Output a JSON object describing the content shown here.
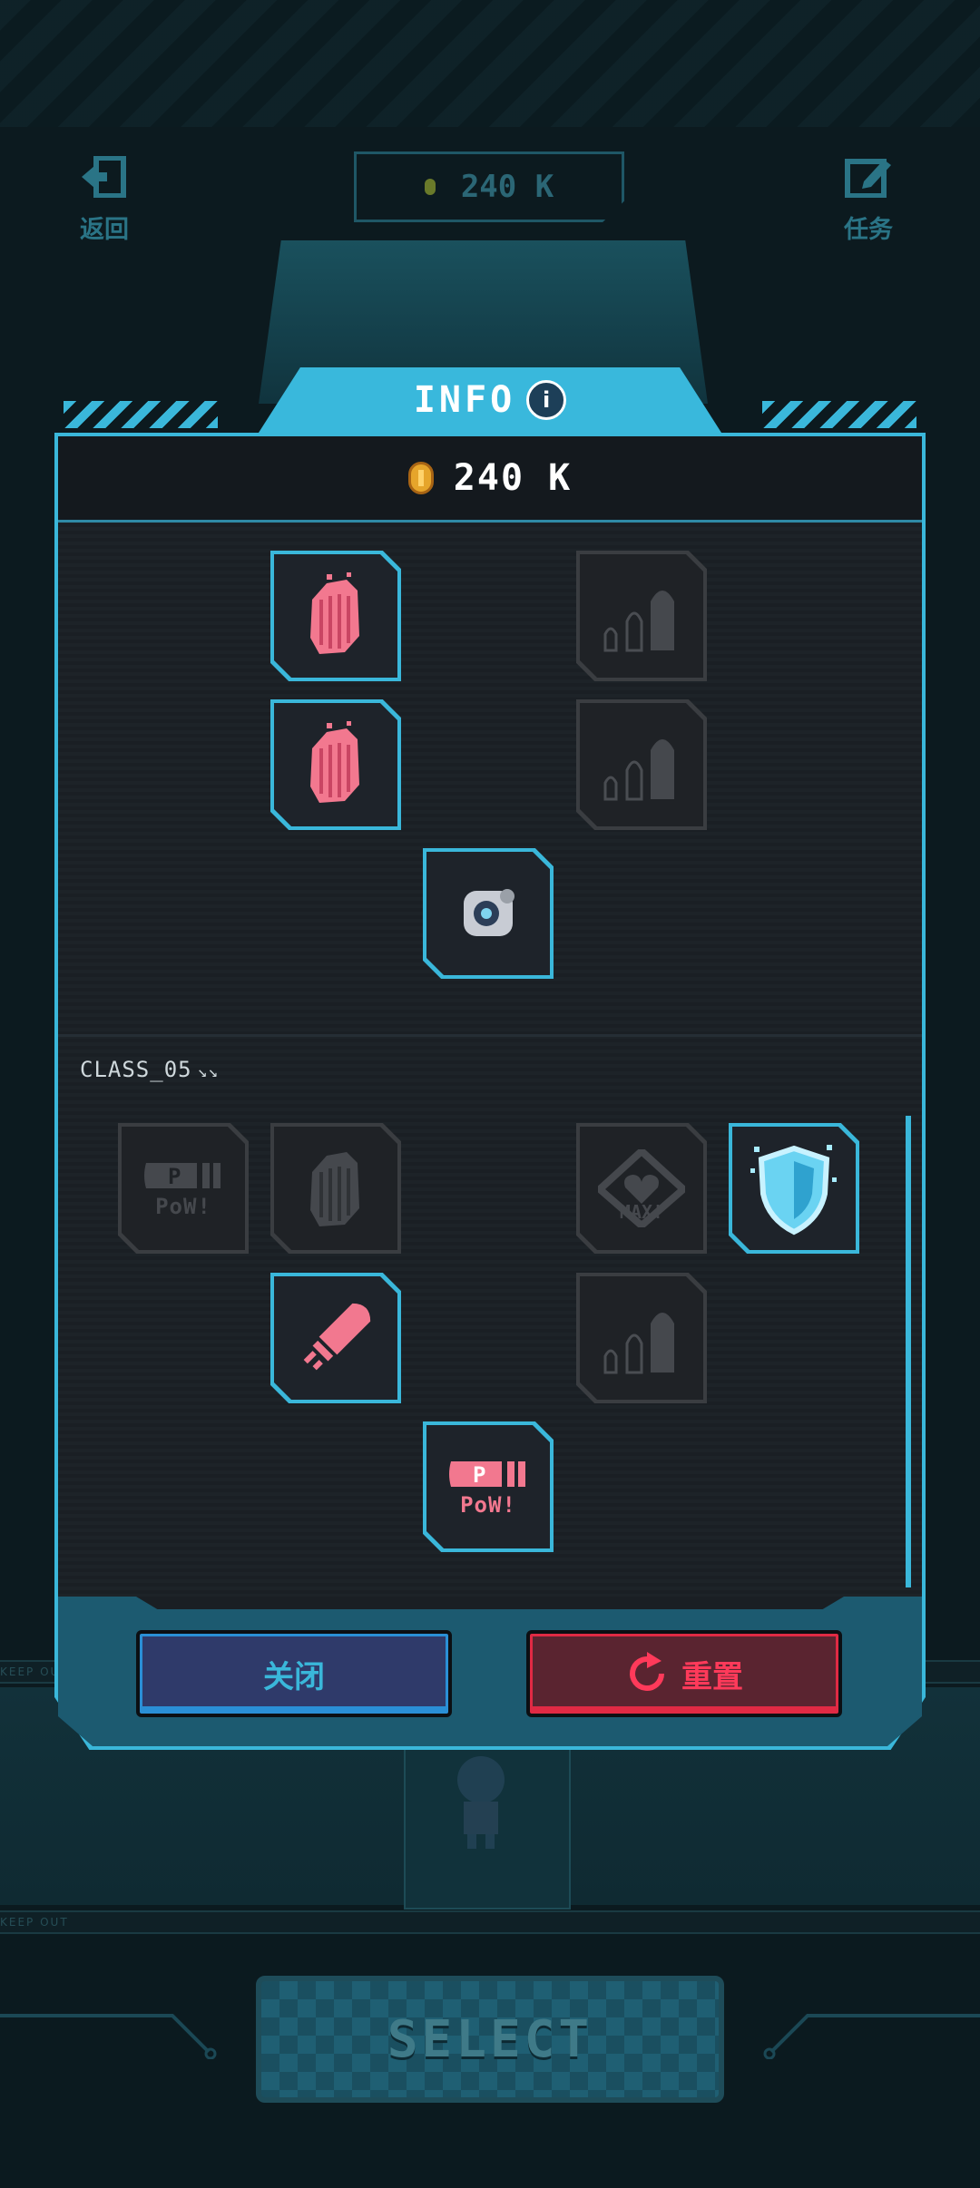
{
  "header": {
    "back_label": "返回",
    "coin_value": "240 K",
    "tasks_label": "任务"
  },
  "dialog": {
    "title": "INFO",
    "coin_value": "240 K",
    "section_label": "CLASS_05",
    "close_label": "关闭",
    "reset_label": "重置"
  },
  "skills": {
    "upper": [
      {
        "icon": "pink-claw-icon",
        "state": "active"
      },
      {
        "icon": "bullets-icon",
        "state": "locked"
      },
      {
        "icon": "pink-claw-icon",
        "state": "active"
      },
      {
        "icon": "bullets-icon",
        "state": "locked"
      },
      {
        "icon": "eye-orb-icon",
        "state": "active"
      }
    ],
    "class05": [
      {
        "icon": "pow-bullet-icon",
        "state": "locked",
        "label": "PoW!"
      },
      {
        "icon": "claw-icon",
        "state": "locked"
      },
      {
        "icon": "heart-max-icon",
        "state": "locked",
        "label": "MAX!"
      },
      {
        "icon": "shield-icon",
        "state": "active"
      },
      {
        "icon": "pink-bullet-icon",
        "state": "active"
      },
      {
        "icon": "bullets-icon",
        "state": "locked"
      },
      {
        "icon": "pow-bullet-icon",
        "state": "active",
        "label": "PoW!"
      }
    ]
  },
  "select_label": "SELECT",
  "tape_text": "KEEP OUT",
  "colors": {
    "accent": "#3ab7da",
    "close_button": "#2f3a6a",
    "reset_button": "#e02a44",
    "skill_pink": "#f2788f"
  }
}
